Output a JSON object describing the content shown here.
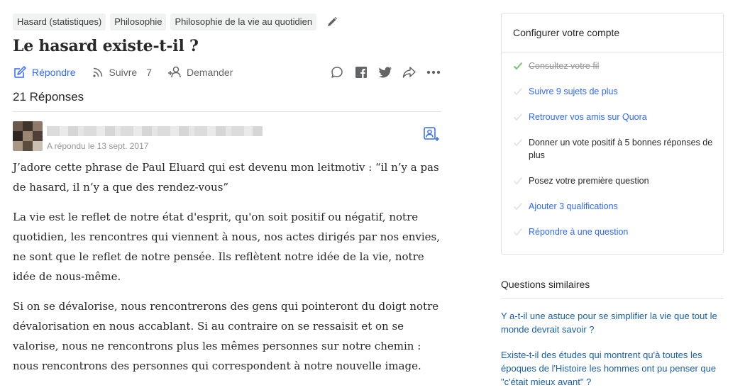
{
  "question": {
    "topics": [
      "Hasard (statistiques)",
      "Philosophie",
      "Philosophie de la vie au quotidien"
    ],
    "title": "Le hasard existe-t-il ?"
  },
  "actions": {
    "answer_label": "Répondre",
    "follow_label": "Suivre",
    "follow_count": "7",
    "request_label": "Demander"
  },
  "answers": {
    "count_label": "21 Réponses"
  },
  "answer": {
    "date": "A répondu le 13 sept. 2017",
    "paragraphs": [
      "J’adore cette phrase de Paul Eluard qui est devenu mon leitmotiv : “il n’y a pas de hasard, il n’y a que des rendez-vous”",
      "La vie est le reflet de notre état d'esprit, qu'on soit positif ou négatif, notre quotidien, les rencontres qui viennent à nous, nos actes dirigés par nos envies, ne sont que le reflet de notre pensée. Ils reflètent notre idée de la vie, notre idée de nous-même.",
      "Si on se dévalorise, nous rencontrerons des gens qui pointeront du doigt notre dévalorisation en nous accablant. Si au contraire on se ressaisit et on se valorise, nous ne rencontrons plus les mêmes personnes sur notre chemin : nous rencontrons des personnes qui correspondent à notre nouvelle image."
    ]
  },
  "sidebar": {
    "setup_title": "Configurer votre compte",
    "setup_items": [
      "Consultez votre fil",
      "Suivre 9 sujets de plus",
      "Retrouver vos amis sur Quora",
      "Donner un vote positif à 5 bonnes réponses de plus",
      "Posez votre première question",
      "Ajouter 3 qualifications",
      "Répondre à une question"
    ],
    "similar_title": "Questions similaires",
    "similar_questions": [
      "Y a-t-il une astuce pour se simplifier la vie que tout le monde devrait savoir ?",
      "Existe-t-il des études qui montrent qu'à toutes les époques de l'Histoire les hommes ont pu penser que \"c'était mieux avant\" ?"
    ]
  },
  "colors": {
    "accent_blue": "#2e69ff",
    "link_blue": "#195faa",
    "check_green": "#78c17f",
    "muted_gray": "#939598",
    "border": "#dee0e1"
  }
}
